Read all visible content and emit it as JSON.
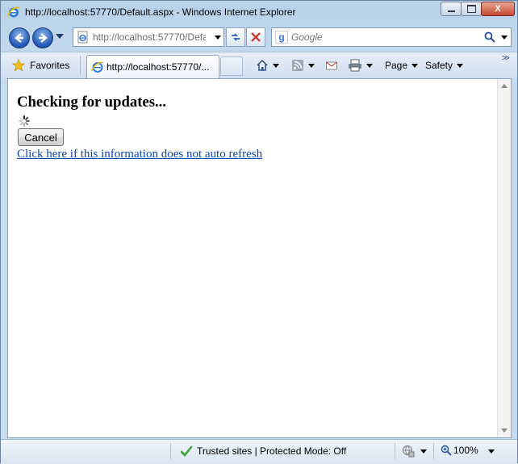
{
  "window": {
    "title": "http://localhost:57770/Default.aspx - Windows Internet Explorer",
    "close_glyph": "X"
  },
  "navigation": {
    "address_value": "http://localhost:57770/Defa",
    "search_placeholder": "Google"
  },
  "tabs": {
    "favorites_label": "Favorites",
    "active_tab_label": "http://localhost:57770/..."
  },
  "commands": {
    "page_label": "Page",
    "safety_label": "Safety",
    "overflow_glyph": ">>"
  },
  "page": {
    "heading": "Checking for updates...",
    "cancel_label": "Cancel",
    "refresh_link": "Click here if this information does not auto refresh"
  },
  "status": {
    "zone_text": "Trusted sites | Protected Mode: Off",
    "zoom_text": "100%"
  },
  "colors": {
    "link": "#0a46ba",
    "chrome_blue": "#c7dbef",
    "trusted_check": "#3da336"
  }
}
